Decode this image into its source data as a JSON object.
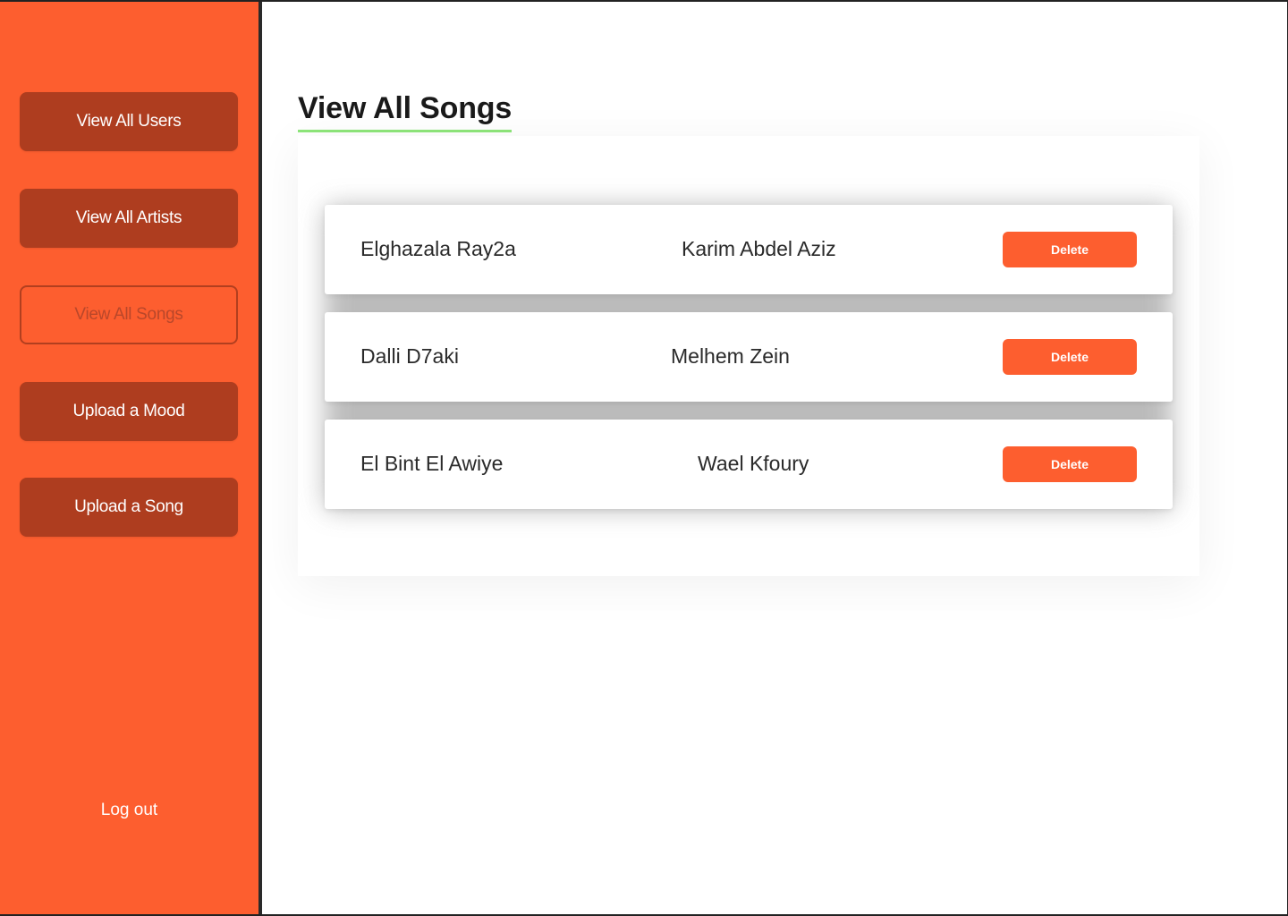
{
  "sidebar": {
    "items": [
      {
        "label": "View All Users"
      },
      {
        "label": "View All Artists"
      },
      {
        "label": "View All Songs",
        "active": true
      },
      {
        "label": "Upload a Mood"
      },
      {
        "label": "Upload a Song"
      }
    ],
    "logout_label": "Log out"
  },
  "main": {
    "title": "View All Songs",
    "songs": [
      {
        "title": "Elghazala Ray2a",
        "artist": "Karim Abdel Aziz",
        "delete_label": "Delete"
      },
      {
        "title": "Dalli D7aki",
        "artist": "Melhem Zein",
        "delete_label": "Delete"
      },
      {
        "title": "El Bint El Awiye",
        "artist": "Wael Kfoury",
        "delete_label": "Delete"
      }
    ]
  },
  "colors": {
    "accent": "#fd5e2f",
    "sidebar_button": "#ae3d1f",
    "title_underline": "#8ee67a"
  }
}
